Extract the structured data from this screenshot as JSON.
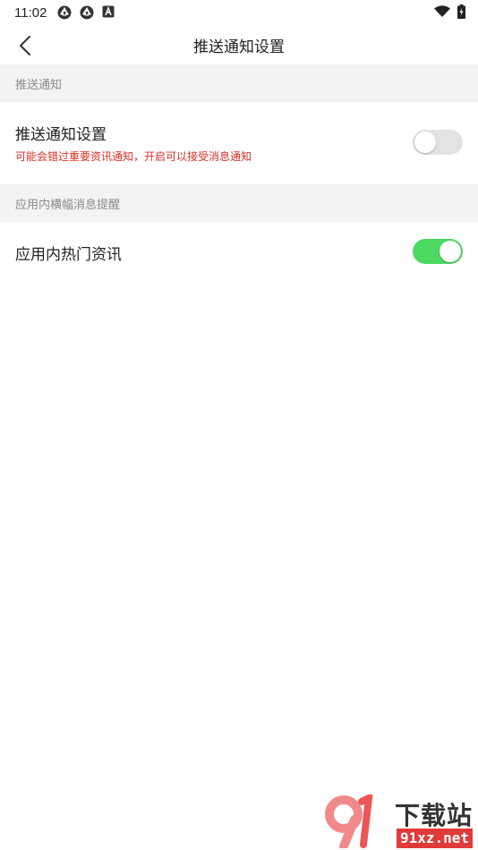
{
  "status_bar": {
    "time": "11:02",
    "icons": [
      "aperture-icon",
      "aperture-icon",
      "font-a-icon"
    ],
    "right_icons": [
      "wifi-icon",
      "battery-icon"
    ]
  },
  "app_bar": {
    "title": "推送通知设置",
    "back_icon": "chevron-left-icon"
  },
  "sections": [
    {
      "header": "推送通知",
      "rows": [
        {
          "label": "推送通知设置",
          "description": "可能会错过重要资讯通知，开启可以接受消息通知",
          "toggle_on": false
        }
      ]
    },
    {
      "header": "应用内横幅消息提醒",
      "rows": [
        {
          "label": "应用内热门资讯",
          "toggle_on": true
        }
      ]
    }
  ],
  "watermark": {
    "brand": "下载站",
    "url": "91xz.net"
  },
  "colors": {
    "toggle_on": "#4cd964",
    "toggle_off": "#e3e3e3",
    "section_bg": "#f3f3f3",
    "description": "#d93025"
  }
}
